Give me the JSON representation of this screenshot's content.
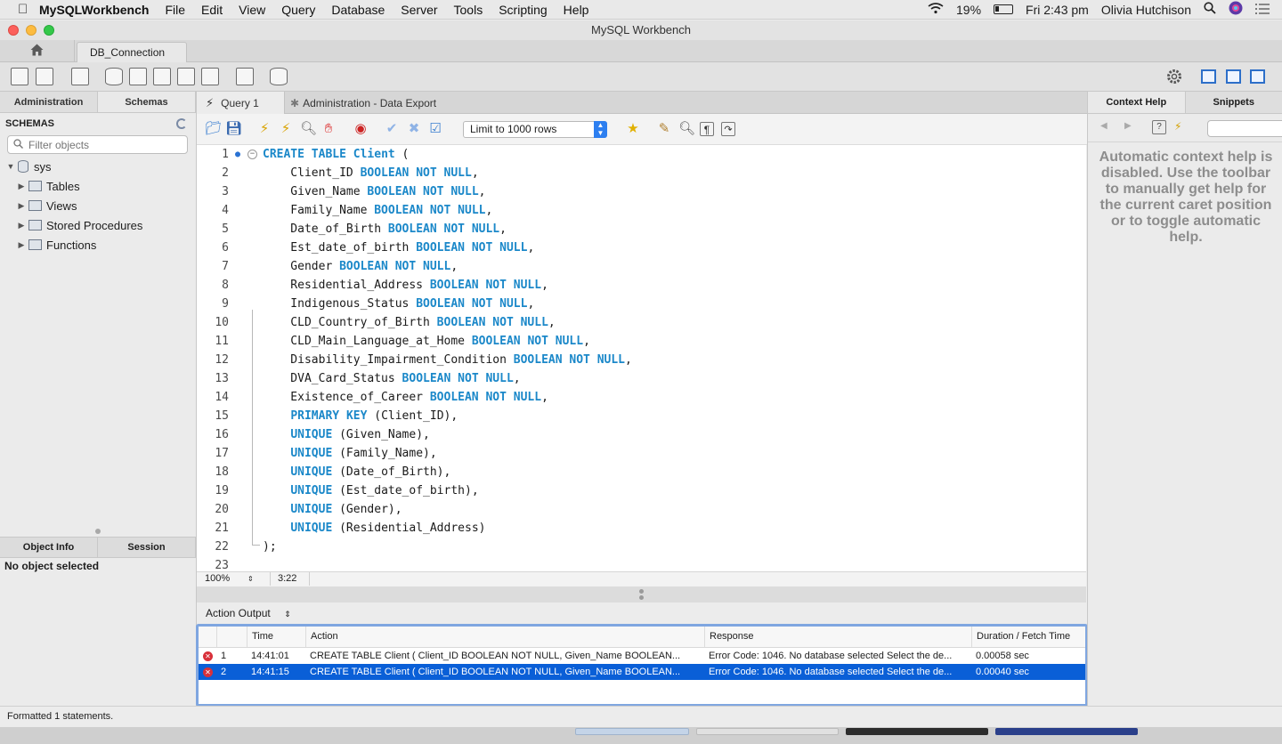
{
  "menubar": {
    "app_name": "MySQLWorkbench",
    "items": [
      "File",
      "Edit",
      "View",
      "Query",
      "Database",
      "Server",
      "Tools",
      "Scripting",
      "Help"
    ],
    "battery": "19%",
    "clock": "Fri 2:43 pm",
    "user": "Olivia Hutchison"
  },
  "window": {
    "title": "MySQL Workbench"
  },
  "connection_tab": {
    "label": "DB_Connection"
  },
  "sidebar": {
    "tabs": [
      "Administration",
      "Schemas"
    ],
    "schemas_title": "SCHEMAS",
    "filter_placeholder": "Filter objects",
    "schema": "sys",
    "children": [
      "Tables",
      "Views",
      "Stored Procedures",
      "Functions"
    ],
    "info_tabs": [
      "Object Info",
      "Session"
    ],
    "no_object": "No object selected"
  },
  "query_tabs": [
    "Query 1",
    "Administration - Data Export"
  ],
  "editor_toolbar": {
    "limit": "Limit to 1000 rows"
  },
  "editor": {
    "lines": [
      {
        "n": "1",
        "code": "CREATE TABLE Client ("
      },
      {
        "n": "2",
        "code": "    Client_ID BOOLEAN NOT NULL,"
      },
      {
        "n": "3",
        "code": "    Given_Name BOOLEAN NOT NULL,"
      },
      {
        "n": "4",
        "code": "    Family_Name BOOLEAN NOT NULL,"
      },
      {
        "n": "5",
        "code": "    Date_of_Birth BOOLEAN NOT NULL,"
      },
      {
        "n": "6",
        "code": "    Est_date_of_birth BOOLEAN NOT NULL,"
      },
      {
        "n": "7",
        "code": "    Gender BOOLEAN NOT NULL,"
      },
      {
        "n": "8",
        "code": "    Residential_Address BOOLEAN NOT NULL,"
      },
      {
        "n": "9",
        "code": "    Indigenous_Status BOOLEAN NOT NULL,"
      },
      {
        "n": "10",
        "code": "    CLD_Country_of_Birth BOOLEAN NOT NULL,"
      },
      {
        "n": "11",
        "code": "    CLD_Main_Language_at_Home BOOLEAN NOT NULL,"
      },
      {
        "n": "12",
        "code": "    Disability_Impairment_Condition BOOLEAN NOT NULL,"
      },
      {
        "n": "13",
        "code": "    DVA_Card_Status BOOLEAN NOT NULL,"
      },
      {
        "n": "14",
        "code": "    Existence_of_Career BOOLEAN NOT NULL,"
      },
      {
        "n": "15",
        "code": "    PRIMARY KEY (Client_ID),"
      },
      {
        "n": "16",
        "code": "    UNIQUE (Given_Name),"
      },
      {
        "n": "17",
        "code": "    UNIQUE (Family_Name),"
      },
      {
        "n": "18",
        "code": "    UNIQUE (Date_of_Birth),"
      },
      {
        "n": "19",
        "code": "    UNIQUE (Est_date_of_birth),"
      },
      {
        "n": "20",
        "code": "    UNIQUE (Gender),"
      },
      {
        "n": "21",
        "code": "    UNIQUE (Residential_Address)"
      },
      {
        "n": "22",
        "code": ");"
      },
      {
        "n": "23",
        "code": ""
      }
    ],
    "keywords": [
      "CREATE",
      "TABLE",
      "Client",
      "BOOLEAN",
      "NOT",
      "NULL",
      "PRIMARY",
      "KEY",
      "UNIQUE"
    ],
    "zoom": "100%",
    "caret": "3:22"
  },
  "output": {
    "selector": "Action Output",
    "columns": [
      "",
      "Time",
      "Action",
      "Response",
      "Duration / Fetch Time"
    ],
    "rows": [
      {
        "n": "1",
        "time": "14:41:01",
        "action": "CREATE TABLE Client (   Client_ID BOOLEAN NOT NULL,   Given_Name BOOLEAN...",
        "response": "Error Code: 1046. No database selected Select the de...",
        "duration": "0.00058 sec"
      },
      {
        "n": "2",
        "time": "14:41:15",
        "action": "CREATE TABLE Client (   Client_ID BOOLEAN NOT NULL,   Given_Name BOOLEAN...",
        "response": "Error Code: 1046. No database selected Select the de...",
        "duration": "0.00040 sec"
      }
    ]
  },
  "right_panel": {
    "tabs": [
      "Context Help",
      "Snippets"
    ],
    "help_text": "Automatic context help is disabled. Use the toolbar to manually get help for the current caret position or to toggle automatic help."
  },
  "status": {
    "text": "Formatted 1 statements."
  },
  "colors": {
    "keyword": "#1b88c9",
    "selection": "#0a5fd7",
    "error": "#d8303a"
  }
}
